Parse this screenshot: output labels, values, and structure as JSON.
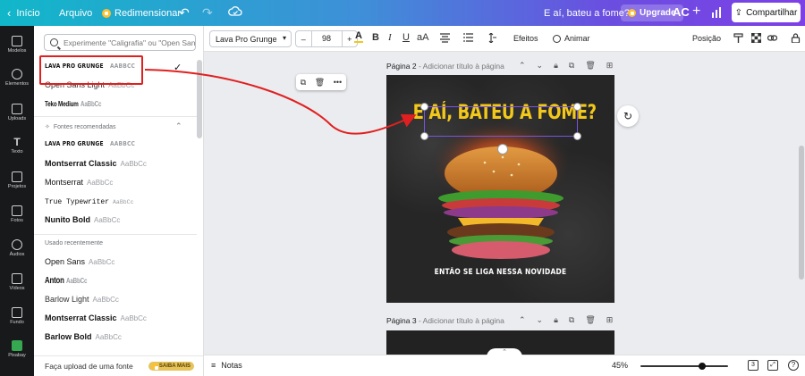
{
  "topbar": {
    "home_label": "Início",
    "file_label": "Arquivo",
    "resize_label": "Redimensionar",
    "doc_title": "E aí, bateu a fome?",
    "upgrade_label": "Upgrade",
    "avatar_initials": "AC",
    "share_label": "Compartilhar"
  },
  "rail": {
    "items": [
      {
        "label": "Modelos"
      },
      {
        "label": "Elementos"
      },
      {
        "label": "Uploads"
      },
      {
        "label": "Texto"
      },
      {
        "label": "Projetos"
      },
      {
        "label": "Fotos"
      },
      {
        "label": "Áudios"
      },
      {
        "label": "Vídeos"
      },
      {
        "label": "Fundo"
      },
      {
        "label": "Pixabay"
      }
    ]
  },
  "font_panel": {
    "search_placeholder": "Experimente \"Caligrafia\" ou \"Open Sans\"",
    "top_fonts": [
      {
        "name": "LAVA PRO GRUNGE",
        "sample": "AABBCC"
      },
      {
        "name": "Open Sans Light",
        "sample": "AaBbCc"
      },
      {
        "name": "Teko Medium",
        "sample": "AaBbCc"
      }
    ],
    "recommended_label": "Fontes recomendadas",
    "recommended": [
      {
        "name": "LAVA PRO GRUNGE",
        "sample": "AABBCC"
      },
      {
        "name": "Montserrat Classic",
        "sample": "AaBbCc"
      },
      {
        "name": "Montserrat",
        "sample": "AaBbCc"
      },
      {
        "name": "True Typewriter",
        "sample": "AaBbCc"
      },
      {
        "name": "Nunito Bold",
        "sample": "AaBbCc"
      }
    ],
    "recent_label": "Usado recentemente",
    "recent": [
      {
        "name": "Open Sans",
        "sample": "AaBbCc"
      },
      {
        "name": "Anton",
        "sample": "AaBbCc"
      },
      {
        "name": "Barlow Light",
        "sample": "AaBbCc"
      },
      {
        "name": "Montserrat Classic",
        "sample": "AaBbCc"
      },
      {
        "name": "Barlow Bold",
        "sample": "AaBbCc"
      }
    ],
    "upload_label": "Faça upload de uma fonte",
    "saiba_label": "SAIBA MAIS"
  },
  "toolbar": {
    "font_name": "Lava Pro Grunge",
    "font_size": "98",
    "minus": "–",
    "plus": "+",
    "effects_label": "Efeitos",
    "animate_label": "Animar",
    "position_label": "Posição",
    "case_label": "aA"
  },
  "canvas": {
    "page2_label": "Página 2",
    "page2_sub": "- Adicionar título à página",
    "page3_label": "Página 3",
    "page3_sub": "- Adicionar título à página",
    "headline": "E AÍ, BATEU A FOME?",
    "subline": "ENTÃO SE LIGA NESSA NOVIDADE"
  },
  "bottombar": {
    "notes_label": "Notas",
    "zoom_label": "45%",
    "zoom_level": 0.45,
    "page_count": "3"
  },
  "colors": {
    "headline_yellow": "#f2c81b",
    "selection_purple": "#7b54e0",
    "annotation_red": "#e02020"
  }
}
